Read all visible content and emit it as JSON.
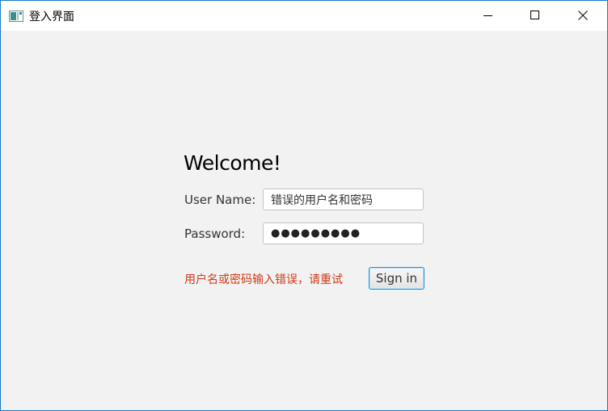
{
  "window": {
    "title": "登入界面",
    "icon": "java-app-icon",
    "controls": {
      "minimize_icon": "minimize-icon",
      "maximize_icon": "maximize-icon",
      "close_icon": "close-icon"
    }
  },
  "form": {
    "welcome": "Welcome!",
    "username_label": "User Name:",
    "username_value": "错误的用户名和密码",
    "password_label": "Password:",
    "password_value": "●●●●●●●●●",
    "error_message": "用户名或密码输入错误，请重试",
    "signin_label": "Sign in"
  },
  "colors": {
    "background": "#f2f2f2",
    "error": "#d03a17",
    "focus_accent": "#1a92d6",
    "window_border": "#1979ca"
  }
}
